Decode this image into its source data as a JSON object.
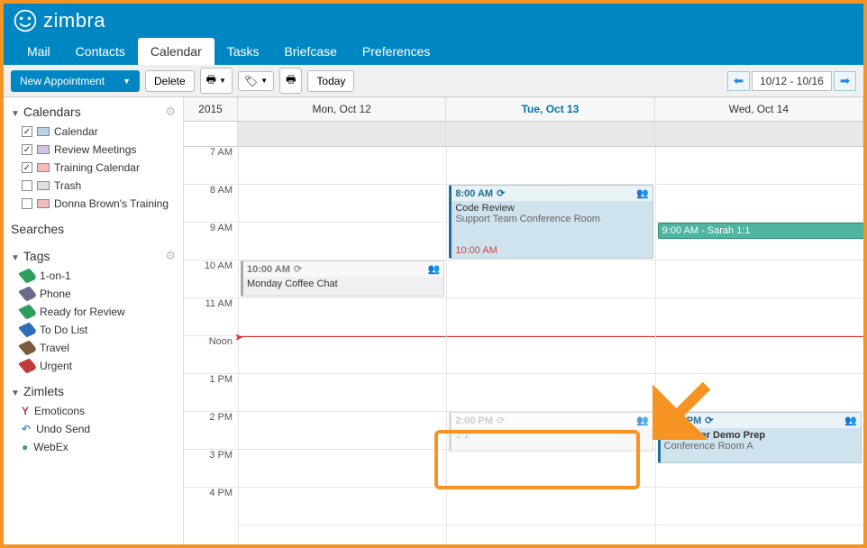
{
  "brand": "zimbra",
  "nav": {
    "mail": "Mail",
    "contacts": "Contacts",
    "calendar": "Calendar",
    "tasks": "Tasks",
    "briefcase": "Briefcase",
    "preferences": "Preferences",
    "active": "calendar"
  },
  "toolbar": {
    "newAppt": "New Appointment",
    "delete": "Delete",
    "today": "Today",
    "dateRange": "10/12 - 10/16"
  },
  "sidebar": {
    "calendarsHeader": "Calendars",
    "calendars": [
      {
        "label": "Calendar",
        "checked": true,
        "color": "#b6d2e6"
      },
      {
        "label": "Review Meetings",
        "checked": true,
        "color": "#d6c3e3"
      },
      {
        "label": "Training Calendar",
        "checked": true,
        "color": "#f2bcbc"
      },
      {
        "label": "Trash",
        "checked": false,
        "color": "#e0e0e0"
      },
      {
        "label": "Donna Brown's Training",
        "checked": false,
        "color": "#f2bcbc",
        "shared": true
      }
    ],
    "searchesHeader": "Searches",
    "tagsHeader": "Tags",
    "tags": [
      {
        "label": "1-on-1",
        "color": "#2e9e5b"
      },
      {
        "label": "Phone",
        "color": "#6a6a8a"
      },
      {
        "label": "Ready for Review",
        "color": "#2e9e5b"
      },
      {
        "label": "To Do List",
        "color": "#2f6fb5"
      },
      {
        "label": "Travel",
        "color": "#7a5c3a"
      },
      {
        "label": "Urgent",
        "color": "#c23a3a"
      }
    ],
    "zimletsHeader": "Zimlets",
    "zimlets": [
      {
        "label": "Emoticons",
        "iconColor": "#c23a3a",
        "glyph": "Y"
      },
      {
        "label": "Undo Send",
        "iconColor": "#5a8ed6",
        "glyph": "↶"
      },
      {
        "label": "WebEx",
        "iconColor": "#3aa657",
        "glyph": "●"
      }
    ]
  },
  "calendar": {
    "year": "2015",
    "days": [
      {
        "label": "Mon, Oct 12",
        "today": false
      },
      {
        "label": "Tue, Oct 13",
        "today": true
      },
      {
        "label": "Wed, Oct 14",
        "today": false
      }
    ],
    "hours": [
      "7 AM",
      "8 AM",
      "9 AM",
      "10 AM",
      "11 AM",
      "Noon",
      "1 PM",
      "2 PM",
      "3 PM",
      "4 PM"
    ],
    "events": {
      "coffee": {
        "time": "10:00 AM",
        "title": "Monday Coffee Chat"
      },
      "code": {
        "time": "8:00 AM",
        "title": "Code Review",
        "loc": "Support Team Conference Room",
        "end": "10:00 AM"
      },
      "sarah": {
        "label": "9:00 AM - Sarah 1:1"
      },
      "ghost": {
        "time": "2:00 PM",
        "title": "1:1"
      },
      "demo": {
        "time": "2:00 PM",
        "title": "Customer Demo Prep",
        "loc": "Conference Room A"
      }
    }
  }
}
